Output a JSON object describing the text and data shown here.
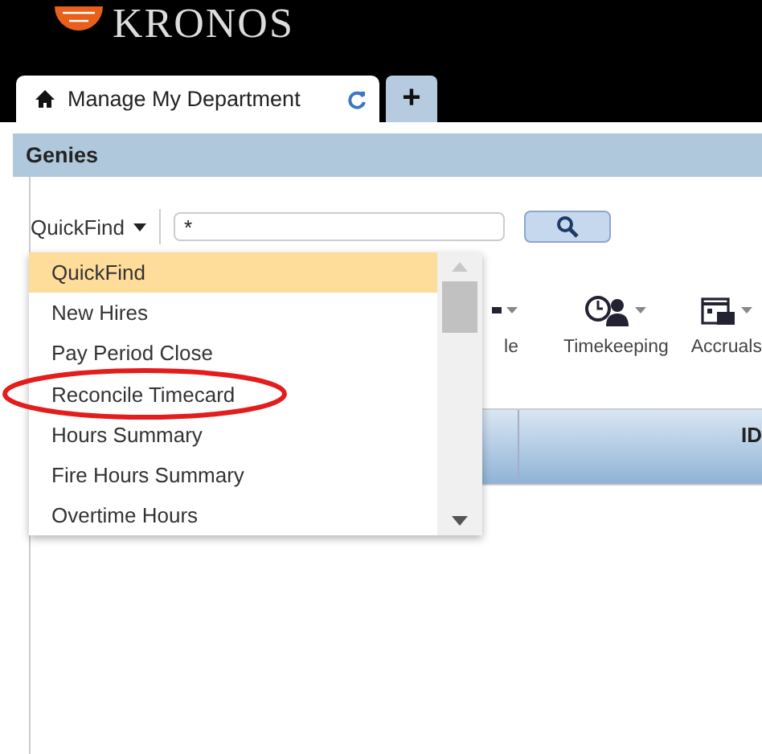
{
  "logo": {
    "text": "KRONOS"
  },
  "tabs": [
    {
      "label": "Manage My Department",
      "selected": true
    },
    {
      "label": "+",
      "selected": false
    }
  ],
  "panel": {
    "title": "Genies"
  },
  "quickfind": {
    "label": "QuickFind",
    "value": "*"
  },
  "toolbar": [
    {
      "label": "le"
    },
    {
      "label": "Timekeeping"
    },
    {
      "label": "Accruals"
    }
  ],
  "table": {
    "columns": [
      "ID"
    ]
  },
  "dropdown": {
    "items": [
      {
        "label": "QuickFind",
        "selected": true
      },
      {
        "label": "New Hires",
        "selected": false
      },
      {
        "label": "Pay Period Close",
        "selected": false
      },
      {
        "label": "Reconcile Timecard",
        "selected": false
      },
      {
        "label": "Hours Summary",
        "selected": false
      },
      {
        "label": "Fire Hours Summary",
        "selected": false
      },
      {
        "label": "Overtime Hours",
        "selected": false
      }
    ]
  }
}
